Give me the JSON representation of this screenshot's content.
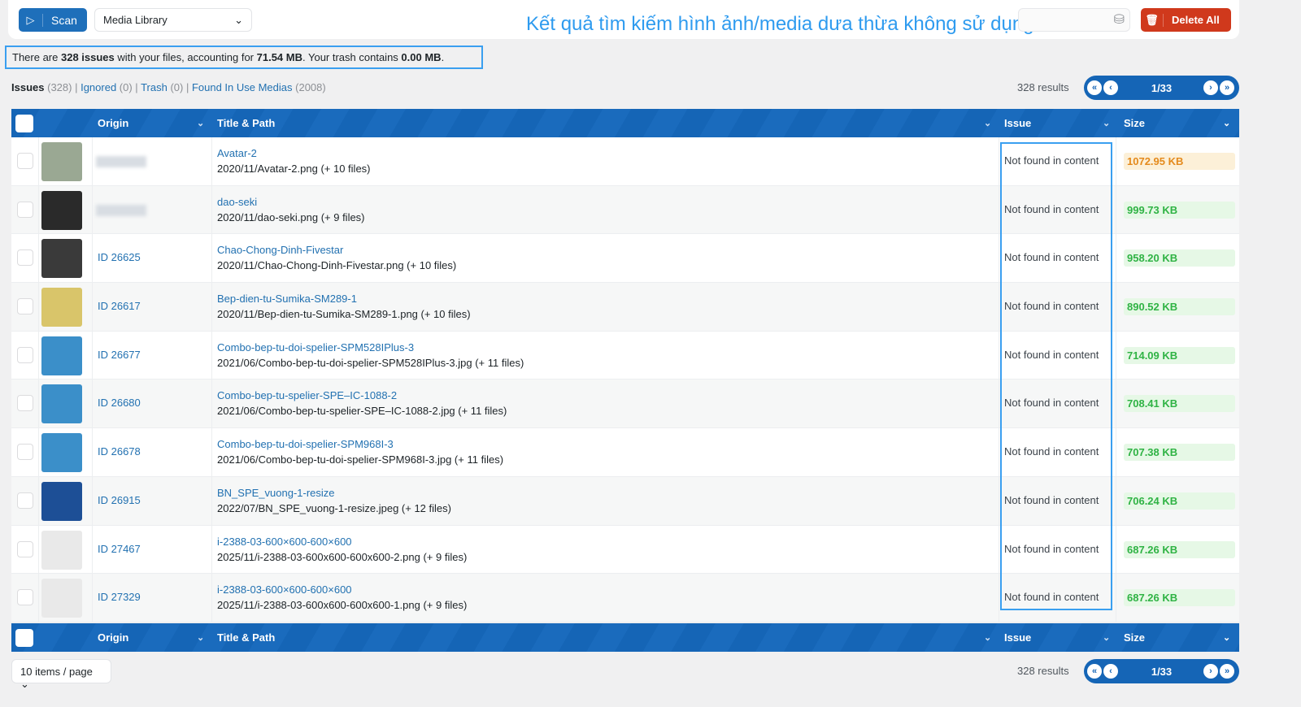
{
  "toolbar": {
    "scan_label": "Scan",
    "source_select": "Media Library",
    "delete_all_label": "Delete All",
    "search_placeholder": ""
  },
  "annotation": "Kết quả tìm kiếm hình ảnh/media dưa thừa không sử dụng",
  "summary": {
    "prefix": "There are ",
    "issues": "328 issues",
    "mid": " with your files, accounting for ",
    "size": "71.54 MB",
    "mid2": ". Your trash contains ",
    "trash": "0.00 MB",
    "end": "."
  },
  "tabs": [
    {
      "label": "Issues",
      "count": "(328)"
    },
    {
      "label": "Ignored",
      "count": "(0)"
    },
    {
      "label": "Trash",
      "count": "(0)"
    },
    {
      "label": "Found In Use Medias",
      "count": "(2008)"
    }
  ],
  "results": "328 results",
  "page": "1/33",
  "columns": {
    "origin": "Origin",
    "title": "Title & Path",
    "issue": "Issue",
    "size": "Size"
  },
  "per_page": "10 items / page",
  "colors": {
    "accent": "#1565b6",
    "danger": "#d0391c",
    "size_large_bg": "#fcf0d8",
    "size_large_text": "#e48a1c",
    "size_bg": "#e6f8e6",
    "size_text": "#2fb344",
    "annotation": "#2e9bef"
  },
  "rows": [
    {
      "origin": "",
      "title": "Avatar-2",
      "path": "2020/11/Avatar-2.png (+ 10 files)",
      "issue": "Not found in content",
      "size": "1072.95 KB",
      "large": true,
      "thumb": "#9aa893"
    },
    {
      "origin": "",
      "title": "dao-seki",
      "path": "2020/11/dao-seki.png (+ 9 files)",
      "issue": "Not found in content",
      "size": "999.73 KB",
      "thumb": "#2a2a2a"
    },
    {
      "origin": "ID 26625",
      "title": "Chao-Chong-Dinh-Fivestar",
      "path": "2020/11/Chao-Chong-Dinh-Fivestar.png (+ 10 files)",
      "issue": "Not found in content",
      "size": "958.20 KB",
      "thumb": "#3a3a3a"
    },
    {
      "origin": "ID 26617",
      "title": "Bep-dien-tu-Sumika-SM289-1",
      "path": "2020/11/Bep-dien-tu-Sumika-SM289-1.png (+ 10 files)",
      "issue": "Not found in content",
      "size": "890.52 KB",
      "thumb": "#d9c56a"
    },
    {
      "origin": "ID 26677",
      "title": "Combo-bep-tu-doi-spelier-SPM528IPlus-3",
      "path": "2021/06/Combo-bep-tu-doi-spelier-SPM528IPlus-3.jpg (+ 11 files)",
      "issue": "Not found in content",
      "size": "714.09 KB",
      "thumb": "#3b8fc9"
    },
    {
      "origin": "ID 26680",
      "title": "Combo-bep-tu-spelier-SPE–IC-1088-2",
      "path": "2021/06/Combo-bep-tu-spelier-SPE–IC-1088-2.jpg (+ 11 files)",
      "issue": "Not found in content",
      "size": "708.41 KB",
      "thumb": "#3b8fc9"
    },
    {
      "origin": "ID 26678",
      "title": "Combo-bep-tu-doi-spelier-SPM968I-3",
      "path": "2021/06/Combo-bep-tu-doi-spelier-SPM968I-3.jpg (+ 11 files)",
      "issue": "Not found in content",
      "size": "707.38 KB",
      "thumb": "#3b8fc9"
    },
    {
      "origin": "ID 26915",
      "title": "BN_SPE_vuong-1-resize",
      "path": "2022/07/BN_SPE_vuong-1-resize.jpeg (+ 12 files)",
      "issue": "Not found in content",
      "size": "706.24 KB",
      "thumb": "#1d4f96"
    },
    {
      "origin": "ID 27467",
      "title": "i-2388-03-600×600-600×600",
      "path": "2025/11/i-2388-03-600x600-600x600-2.png (+ 9 files)",
      "issue": "Not found in content",
      "size": "687.26 KB",
      "thumb": "#e9e9e9"
    },
    {
      "origin": "ID 27329",
      "title": "i-2388-03-600×600-600×600",
      "path": "2025/11/i-2388-03-600x600-600x600-1.png (+ 9 files)",
      "issue": "Not found in content",
      "size": "687.26 KB",
      "thumb": "#e9e9e9"
    }
  ]
}
